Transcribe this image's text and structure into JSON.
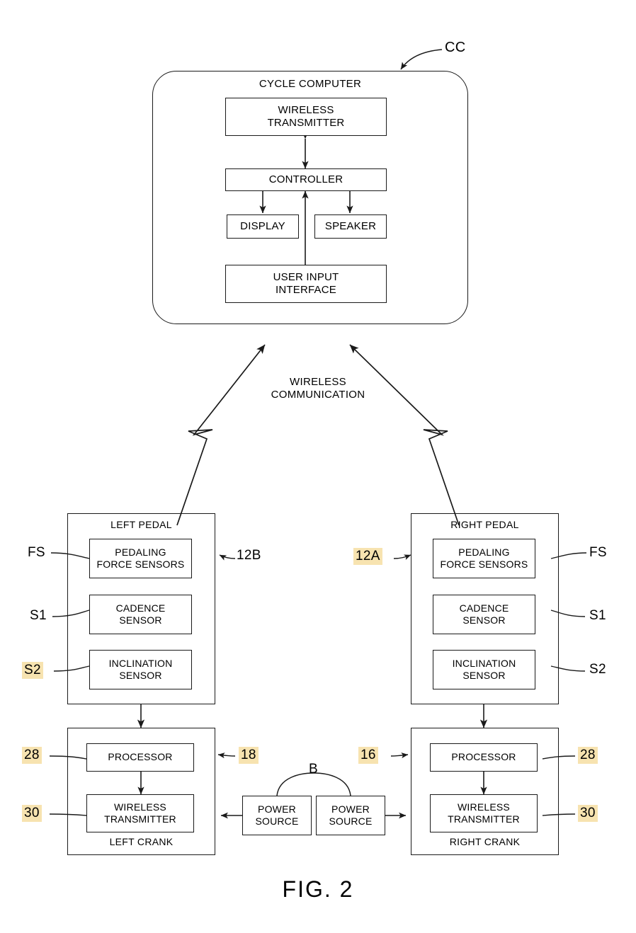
{
  "figure": {
    "label": "FIG. 2",
    "title_ref": "CC"
  },
  "cycle_computer": {
    "title": "CYCLE COMPUTER",
    "blocks": {
      "wireless_transmitter": "WIRELESS\nTRANSMITTER",
      "controller": "CONTROLLER",
      "display": "DISPLAY",
      "speaker": "SPEAKER",
      "user_input_interface": "USER INPUT\nINTERFACE"
    }
  },
  "wireless_link": {
    "label": "WIRELESS\nCOMMUNICATION"
  },
  "left_pedal": {
    "title": "LEFT PEDAL",
    "ref": "12B",
    "ref_highlighted": false,
    "sensors": [
      {
        "label": "PEDALING\nFORCE SENSORS",
        "ref": "FS",
        "ref_highlighted": false
      },
      {
        "label": "CADENCE\nSENSOR",
        "ref": "S1",
        "ref_highlighted": false
      },
      {
        "label": "INCLINATION\nSENSOR",
        "ref": "S2",
        "ref_highlighted": true
      }
    ]
  },
  "right_pedal": {
    "title": "RIGHT PEDAL",
    "ref": "12A",
    "ref_highlighted": true,
    "sensors": [
      {
        "label": "PEDALING\nFORCE SENSORS",
        "ref": "FS",
        "ref_highlighted": false
      },
      {
        "label": "CADENCE\nSENSOR",
        "ref": "S1",
        "ref_highlighted": false
      },
      {
        "label": "INCLINATION\nSENSOR",
        "ref": "S2",
        "ref_highlighted": false
      }
    ]
  },
  "left_crank": {
    "title": "LEFT CRANK",
    "ref": "18",
    "ref_highlighted": true,
    "blocks": [
      {
        "label": "PROCESSOR",
        "ref": "28",
        "ref_highlighted": true
      },
      {
        "label": "WIRELESS\nTRANSMITTER",
        "ref": "30",
        "ref_highlighted": true
      }
    ]
  },
  "right_crank": {
    "title": "RIGHT CRANK",
    "ref": "16",
    "ref_highlighted": true,
    "blocks": [
      {
        "label": "PROCESSOR",
        "ref": "28",
        "ref_highlighted": true
      },
      {
        "label": "WIRELESS\nTRANSMITTER",
        "ref": "30",
        "ref_highlighted": true
      }
    ]
  },
  "power": {
    "bracket_ref": "B",
    "left_source": "POWER\nSOURCE",
    "right_source": "POWER\nSOURCE"
  },
  "colors": {
    "ink": "#1a1a1a",
    "highlight": "#f7e3b0",
    "background": "#ffffff"
  }
}
